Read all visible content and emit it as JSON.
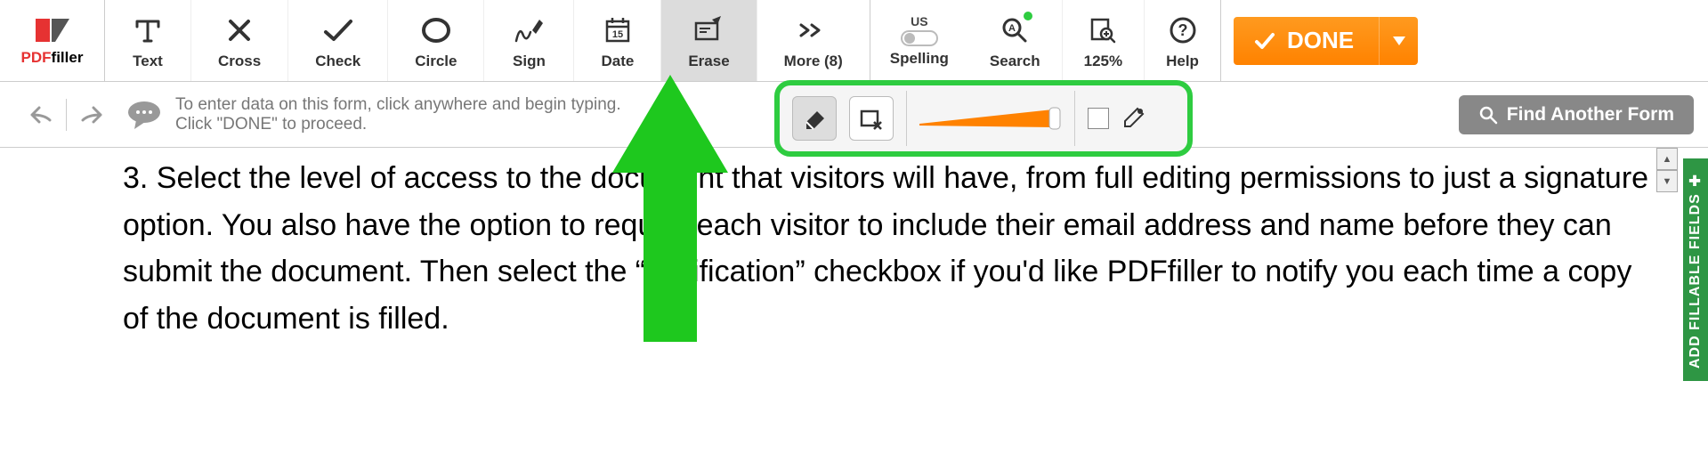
{
  "app": {
    "name_prefix": "PDF",
    "name_suffix": "filler"
  },
  "toolbar": {
    "text_label": "Text",
    "cross_label": "Cross",
    "check_label": "Check",
    "circle_label": "Circle",
    "sign_label": "Sign",
    "date_label": "Date",
    "erase_label": "Erase",
    "more_label": "More (8)",
    "spelling_us": "US",
    "spelling_label": "Spelling",
    "search_label": "Search",
    "zoom_label": "125%",
    "help_label": "Help",
    "done_label": "DONE"
  },
  "secondary": {
    "hint_line1": "To enter data on this form, click anywhere and begin typing.",
    "hint_line2": "Click \"DONE\" to proceed.",
    "find_label": "Find Another Form"
  },
  "erase_panel": {
    "color": "#ffffff"
  },
  "sidebar": {
    "add_fields_label": "ADD FILLABLE FIELDS"
  },
  "document": {
    "body_text": "3. Select the level of access to the document that visitors will have, from full editing permissions to just a signature option. You also have the option to require each visitor to include their email address and name before they can submit the document. Then select the “Notification” checkbox if you'd like PDFfiller to notify you each time a copy of the document is filled."
  }
}
